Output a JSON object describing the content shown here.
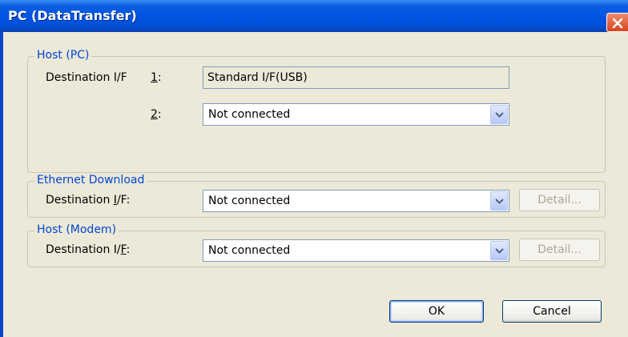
{
  "window": {
    "title": "PC (DataTransfer)"
  },
  "host_pc": {
    "legend": "Host (PC)",
    "destination_label": "Destination I/F",
    "row1_number": "1",
    "row1_suffix": ":",
    "row1_value": "Standard I/F(USB)",
    "row2_number": "2",
    "row2_suffix": ":",
    "row2_value": "Not connected"
  },
  "ethernet": {
    "legend": "Ethernet Download",
    "label_prefix": "Destination ",
    "label_mnemonic": "I",
    "label_suffix": "/F:",
    "value": "Not connected",
    "detail_label": "Detail..."
  },
  "modem": {
    "legend": "Host (Modem)",
    "label_prefix": "Destination I/",
    "label_mnemonic": "F",
    "label_suffix": ":",
    "value": "Not connected",
    "detail_label": "Detail..."
  },
  "buttons": {
    "ok": "OK",
    "cancel": "Cancel"
  },
  "colors": {
    "titlebar": "#0054e3",
    "dialog_bg": "#ece9d8",
    "legend_text": "#0046d5",
    "close_button": "#d8441e"
  }
}
